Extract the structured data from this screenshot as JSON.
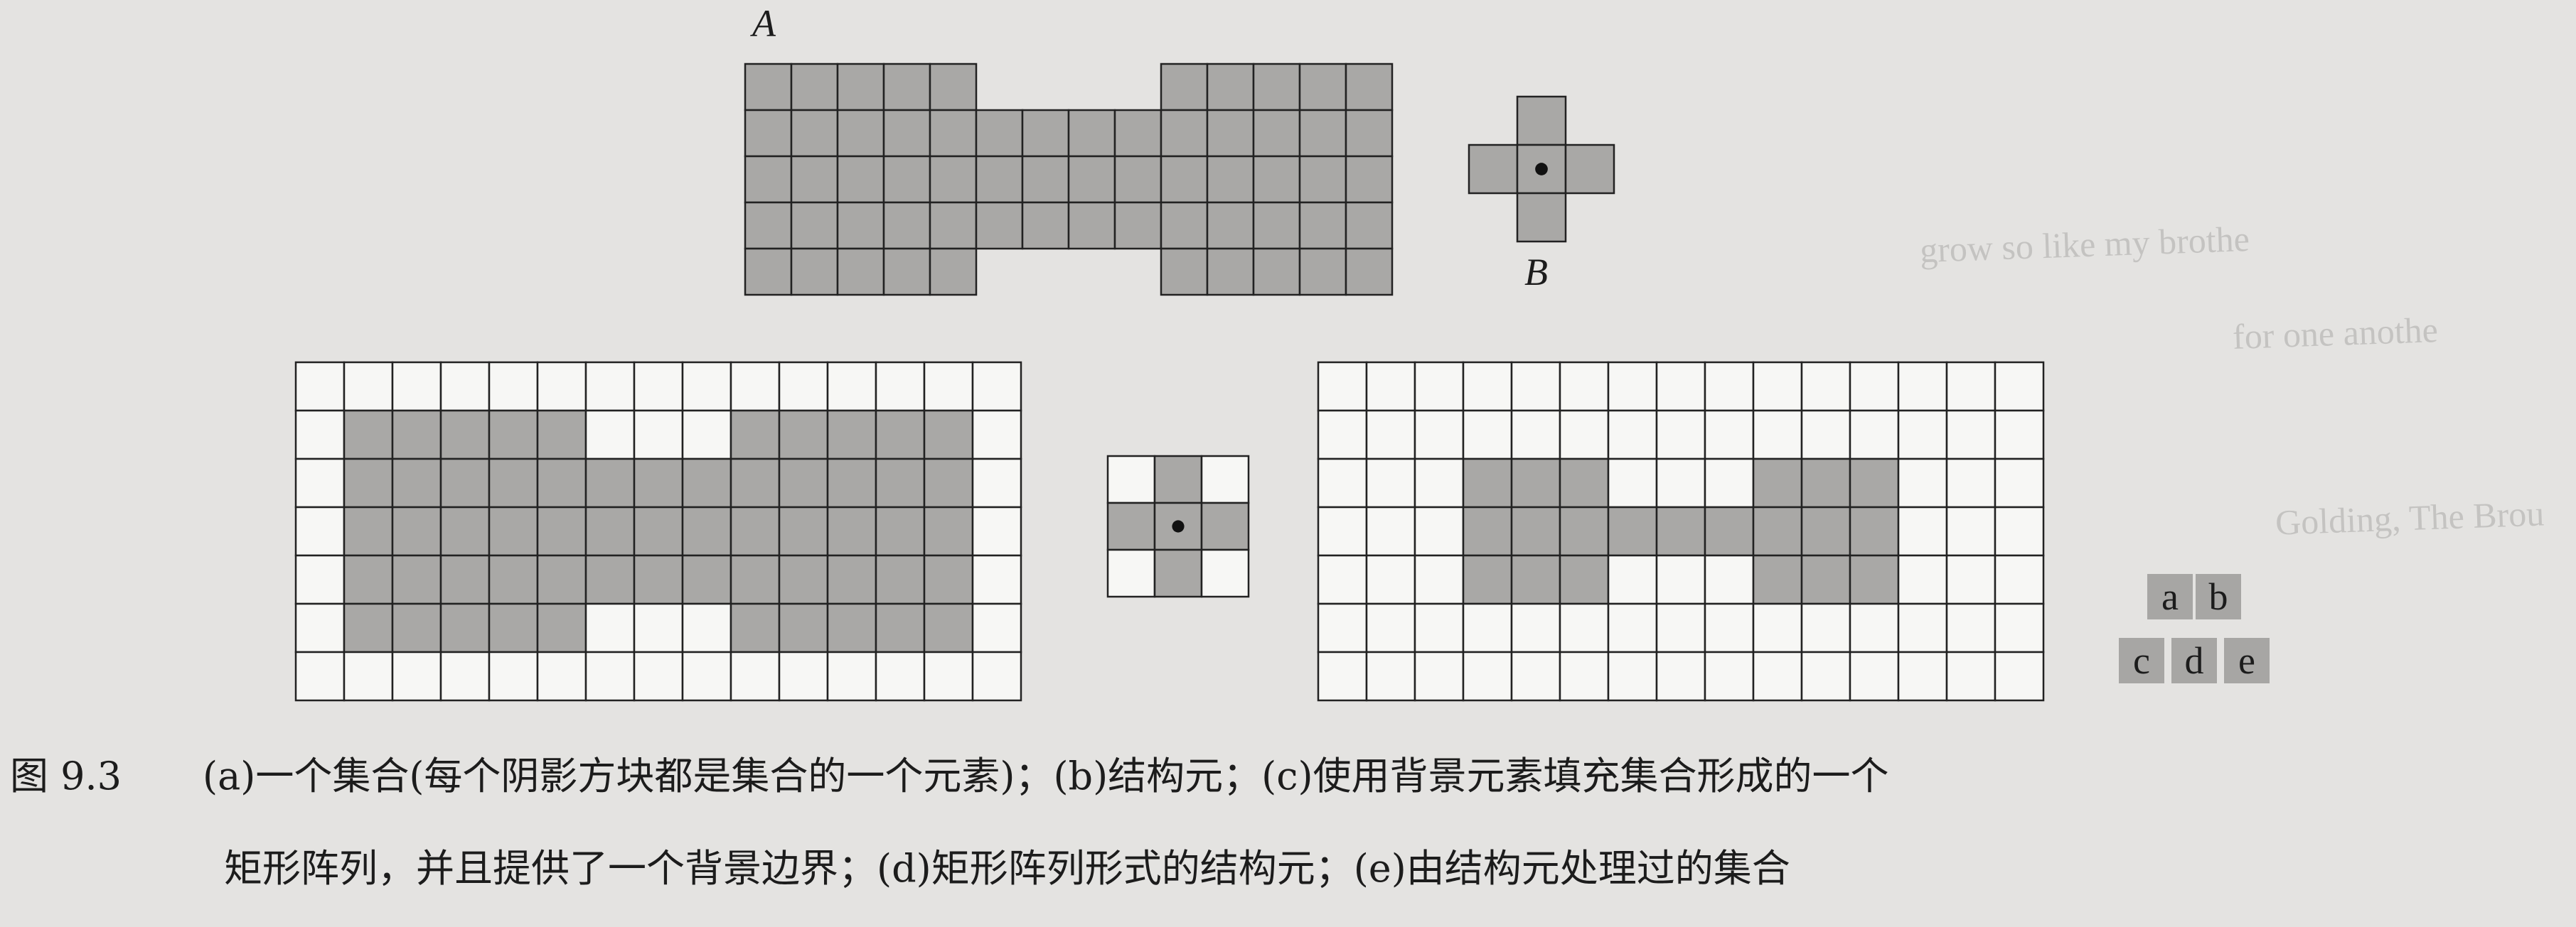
{
  "figure": {
    "labels": {
      "a_set": "A",
      "b_struct": "B"
    },
    "panels": {
      "a": {
        "rows": 5,
        "cols": 14,
        "cells": [
          "11111000011111",
          "11111111111111",
          "11111111111111",
          "11111111111111",
          "11111000011111"
        ],
        "blank_draw": false
      },
      "b": {
        "rows": 3,
        "cols": 3,
        "cells": [
          "010",
          "111",
          "010"
        ],
        "blank_draw": false,
        "origin": [
          1,
          1
        ]
      },
      "c": {
        "rows": 7,
        "cols": 15,
        "cells": [
          "000000000000000",
          "011111000111110",
          "011111111111110",
          "011111111111110",
          "011111111111110",
          "011111000111110",
          "000000000000000"
        ],
        "blank_draw": true
      },
      "d": {
        "rows": 3,
        "cols": 3,
        "cells": [
          "010",
          "111",
          "010"
        ],
        "blank_draw": true,
        "origin": [
          1,
          1
        ]
      },
      "e": {
        "rows": 7,
        "cols": 15,
        "cells": [
          "000000000000000",
          "000000000000000",
          "000111000111000",
          "000111111111000",
          "000111000111000",
          "000000000000000",
          "000000000000000"
        ],
        "blank_draw": true
      }
    },
    "legend": {
      "a": "a",
      "b": "b",
      "c": "c",
      "d": "d",
      "e": "e"
    },
    "colors": {
      "fill": "#a9a8a6",
      "line": "#222222",
      "blank": "#f7f7f5",
      "background": "#e4e3e1"
    }
  },
  "caption": {
    "number": "图 9.3",
    "line1": "(a)一个集合(每个阴影方块都是集合的一个元素)；(b)结构元；(c)使用背景元素填充集合形成的一个",
    "line2": "矩形阵列，并且提供了一个背景边界；(d)矩形阵列形式的结构元；(e)由结构元处理过的集合"
  },
  "bleed_through": {
    "line1": "grow so like my brothe",
    "line2": "for one anothe",
    "line3": "Golding, The Brou"
  }
}
